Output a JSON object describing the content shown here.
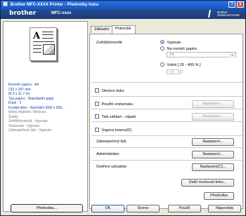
{
  "window": {
    "title": "Brother MFC-XXXX Printer - Předvolby tisku",
    "help_symbol": "?",
    "close_symbol": "X"
  },
  "brand": {
    "logo": "brother",
    "model": "MFC-xxxx",
    "solutions_line1": "Brother",
    "solutions_line2": "SolutionsCenter"
  },
  "tabs": [
    {
      "label": "Základní"
    },
    {
      "label": "Pokročilé"
    }
  ],
  "preview": {
    "letter": "A"
  },
  "summary": [
    "Rozměr papíru : A4",
    "210 x 297 mm",
    "(8.3 x 11.7 in)",
    "",
    "Typ papíru : Standardní papír",
    "Kopií : 2",
    "Kvalita tisku : Normální (600 x 600...",
    "Nízký doplněk / Brožura",
    "Žádný",
    "Zvětšit/zmenšit : Vypnuto",
    "Vodoznak : Vypnuto",
    "Zabezpečený tisk : Vypnuto"
  ],
  "summary_muted": [
    false,
    false,
    false,
    false,
    false,
    false,
    false,
    true,
    true,
    true,
    true,
    true
  ],
  "left_footer": {
    "default_button": "Předvolba..."
  },
  "advanced": {
    "scale_label": "Zvětšit/zmenšit",
    "radio_off": "Vypnuto",
    "radio_fit": "Na rozměr papíru",
    "paper_select": "A4",
    "radio_free": "Volně [ 25 - 400 % ]",
    "percent": "100",
    "reverse_print": "Otočení tisku",
    "use_watermark": "Použití vodoznaku",
    "watermark_settings": "Nastavení...",
    "header_footer": "Tisk záhlaví - zápatí",
    "header_footer_settings": "Nastavení...",
    "toner_save": "Úspora toneru(D)",
    "secure_print": "Zabezpečený tisk",
    "secure_settings": "Nastavení...",
    "administrator": "Administrátor",
    "admin_settings": "Nastavení...",
    "user_auth": "Ověření uživatele",
    "user_settings": "Nastavení(C)...",
    "other_options": "Další možnosti tisku...",
    "default": "Předvolba"
  },
  "footer": {
    "ok": "OK",
    "cancel": "Storno",
    "apply": "Použít",
    "help": "Nápověda"
  }
}
